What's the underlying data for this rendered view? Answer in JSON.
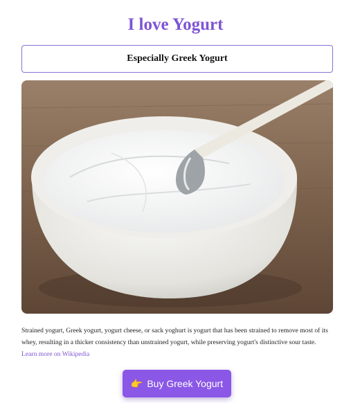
{
  "header": {
    "title": "I love Yogurt"
  },
  "subtitle": {
    "text": "Especially Greek Yogurt"
  },
  "image": {
    "alt": "A white bowl of strained Greek yogurt with a spoon on a wooden table"
  },
  "description": {
    "text": "Strained yogurt, Greek yogurt, yogurt cheese, or sack yoghurt is yogurt that has been strained to remove most of its whey, resulting in a thicker consistency than unstrained yogurt, while preserving yogurt's distinctive sour taste."
  },
  "links": {
    "wikipedia": "Learn more on Wikipedia"
  },
  "cta": {
    "icon": "pointing-hand-icon",
    "label": "Buy Greek Yogurt"
  },
  "colors": {
    "accent": "#7e54d4",
    "button": "#8a57e6"
  }
}
